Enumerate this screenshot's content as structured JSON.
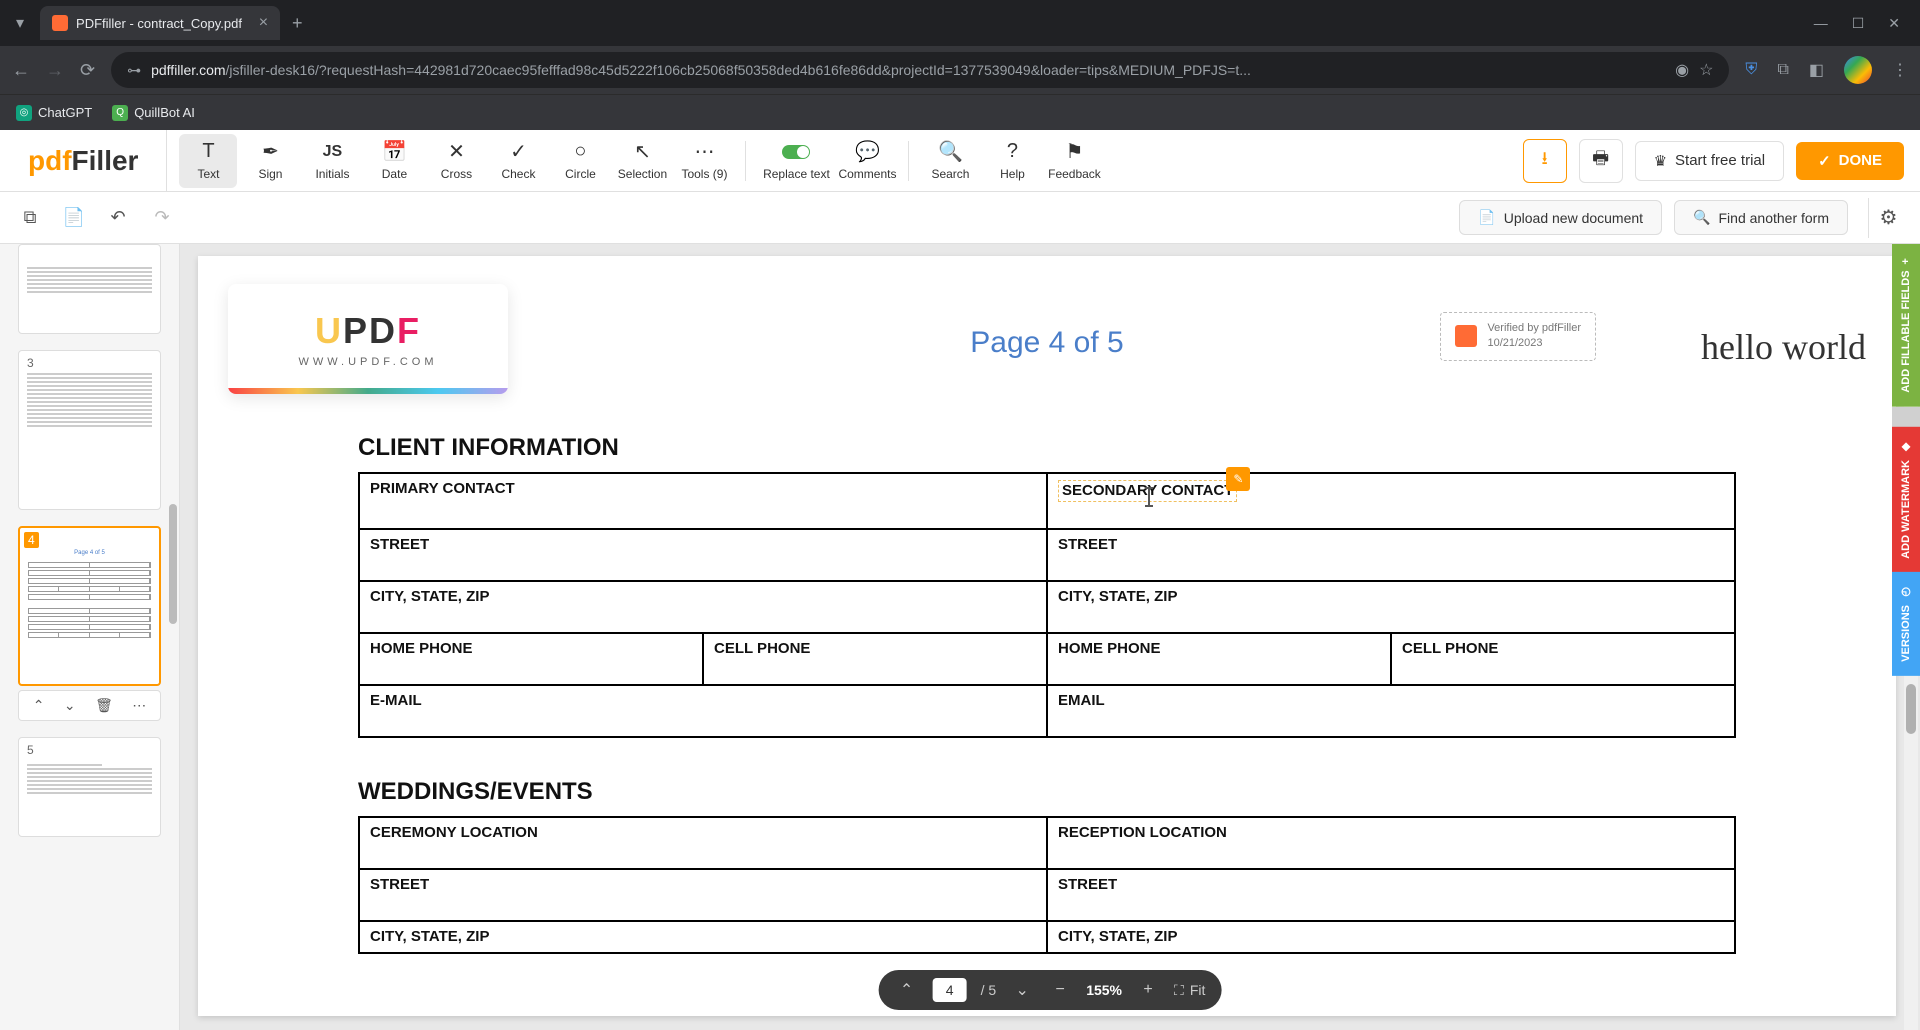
{
  "browser": {
    "tab_title": "PDFfiller - contract_Copy.pdf",
    "url_host": "pdffiller.com",
    "url_path": "/jsfiller-desk16/?requestHash=442981d720caec95fefffad98c45d5222f106cb25068f50358ded4b616fe86dd&projectId=1377539049&loader=tips&MEDIUM_PDFJS=t...",
    "bookmarks": [
      {
        "label": "ChatGPT",
        "color": "#10a37f"
      },
      {
        "label": "QuillBot AI",
        "color": "#4caf50"
      }
    ]
  },
  "logo": {
    "pdf": "pdf",
    "filler": "Filler"
  },
  "toolbar": {
    "text": "Text",
    "sign": "Sign",
    "initials": "Initials",
    "date": "Date",
    "cross": "Cross",
    "check": "Check",
    "circle": "Circle",
    "selection": "Selection",
    "tools": "Tools (9)",
    "replace_text": "Replace text",
    "comments": "Comments",
    "search": "Search",
    "help": "Help",
    "feedback": "Feedback"
  },
  "header_right": {
    "start_trial": "Start free trial",
    "done": "DONE"
  },
  "sub_header": {
    "upload": "Upload new document",
    "find": "Find another form"
  },
  "thumbnails": {
    "pages": [
      {
        "num": ""
      },
      {
        "num": "3"
      },
      {
        "num": "4"
      },
      {
        "num": "5"
      }
    ]
  },
  "document": {
    "updf_name": "UPDF",
    "updf_url": "WWW.UPDF.COM",
    "page_indicator": "Page 4 of 5",
    "verified_label": "Verified by pdfFiller",
    "verified_date": "10/21/2023",
    "user_text": "hello world",
    "section1_title": "CLIENT INFORMATION",
    "section2_title": "WEDDINGS/EVENTS",
    "fields": {
      "primary_contact": "PRIMARY CONTACT",
      "secondary_contact": "SECONDARY CONTACT",
      "street": "STREET",
      "city_state_zip": "CITY, STATE, ZIP",
      "home_phone": "HOME PHONE",
      "cell_phone": "CELL PHONE",
      "email1": "E-MAIL",
      "email2": "EMAIL",
      "ceremony_location": "CEREMONY LOCATION",
      "reception_location": "RECEPTION LOCATION"
    }
  },
  "page_nav": {
    "current": "4",
    "total": "/ 5",
    "zoom": "155%",
    "fit": "Fit"
  },
  "side_tabs": {
    "fields": "ADD FILLABLE FIELDS",
    "watermark": "ADD WATERMARK",
    "versions": "VERSIONS"
  }
}
